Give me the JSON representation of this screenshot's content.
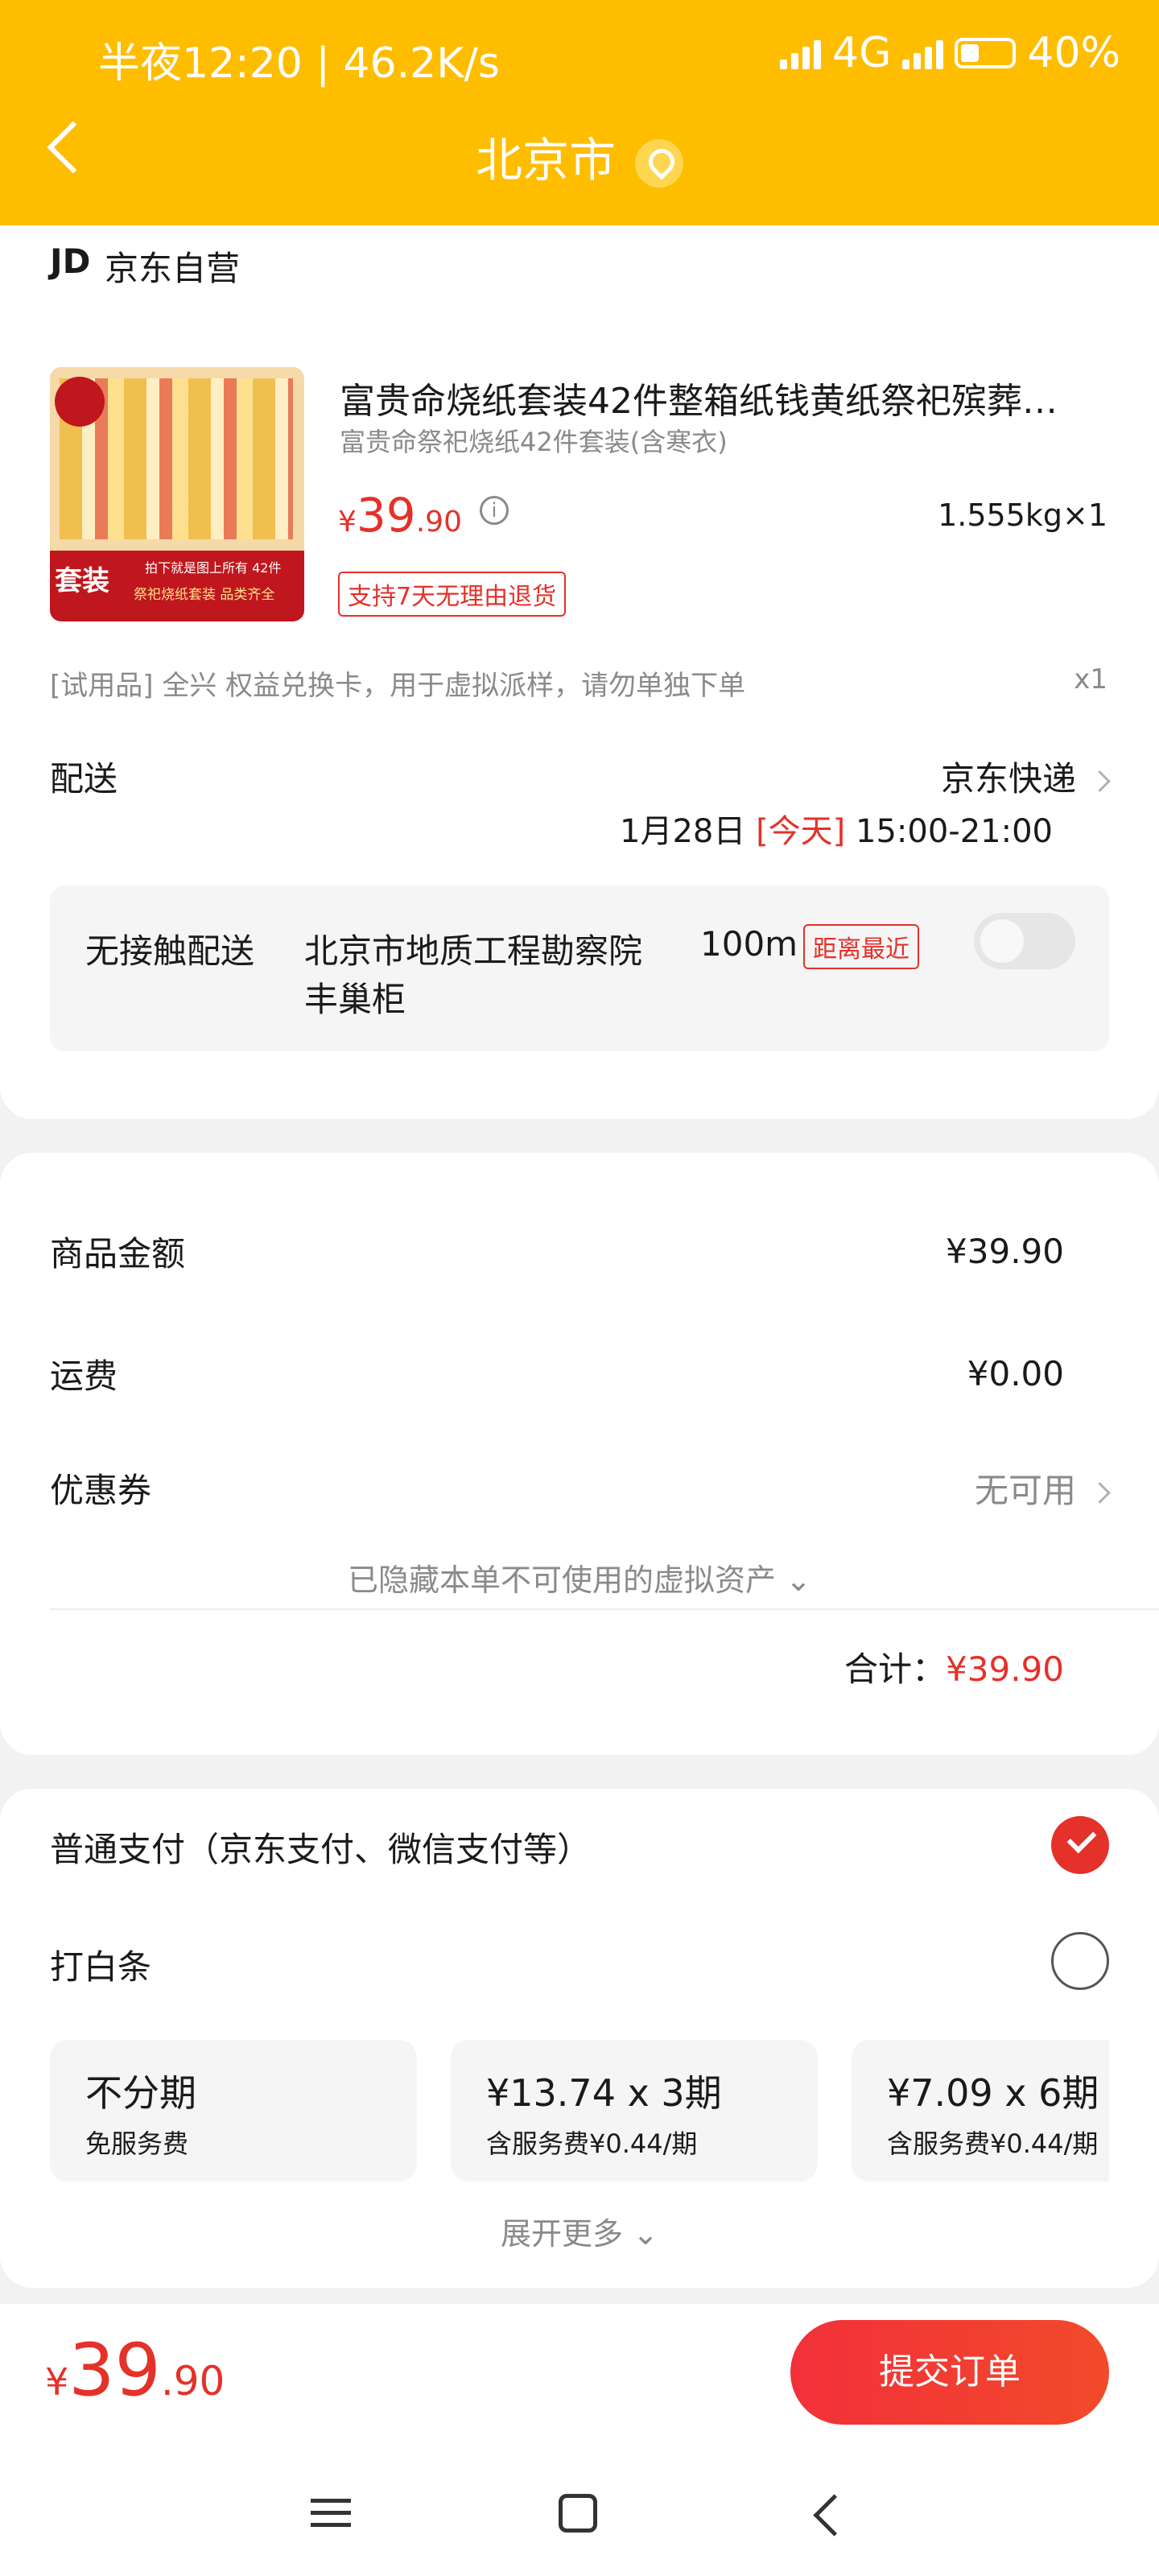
{
  "status_bar": {
    "time_speed": "半夜12:20 | 46.2K/s",
    "network": "4G",
    "battery": "40%"
  },
  "header": {
    "title": "北京市"
  },
  "shop": {
    "logo": "JD",
    "name": "京东自营"
  },
  "product": {
    "title": "富贵命烧纸套装42件整箱纸钱黄纸祭祀殡葬…",
    "variant": "富贵命祭祀烧纸42件套装(含寒衣)",
    "price_symbol": "¥",
    "price_int": "39",
    "price_dec": ".90",
    "weight_qty": "1.555kg×1",
    "return_tag": "支持7天无理由退货",
    "thumb_badge": "套装",
    "thumb_line1": "拍下就是图上所有 42件",
    "thumb_line2": "祭祀烧纸套装 品类齐全"
  },
  "trial": {
    "text": "[试用品]  全兴 权益兑换卡，用于虚拟派样，请勿单独下单",
    "qty": "x1"
  },
  "delivery": {
    "label": "配送",
    "carrier": "京东快递",
    "date": "1月28日",
    "today": "[今天]",
    "time": "15:00-21:00",
    "contactless_label": "无接触配送",
    "locker_addr": "北京市地质工程勘察院",
    "distance": "100m",
    "nearest_tag": "距离最近",
    "locker_name": "丰巢柜"
  },
  "summary": {
    "goods_label": "商品金额",
    "goods_value": "¥39.90",
    "shipping_label": "运费",
    "shipping_value": "¥0.00",
    "coupon_label": "优惠券",
    "coupon_value": "无可用",
    "hidden_assets": "已隐藏本单不可使用的虚拟资产",
    "total_label": "合计：",
    "total_value": "¥39.90"
  },
  "payment": {
    "normal_label": "普通支付（京东支付、微信支付等）",
    "baitiao_label": "打白条",
    "installments": [
      {
        "title": "不分期",
        "sub": "免服务费"
      },
      {
        "title": "¥13.74 x 3期",
        "sub": "含服务费¥0.44/期"
      },
      {
        "title": "¥7.09 x 6期",
        "sub": "含服务费¥0.44/期"
      }
    ],
    "expand_more": "展开更多"
  },
  "footer": {
    "price_symbol": "¥",
    "price_int": "39",
    "price_dec": ".90",
    "submit_label": "提交订单"
  },
  "colors": {
    "header": "#ffbd00",
    "accent_red": "#e4312a"
  }
}
